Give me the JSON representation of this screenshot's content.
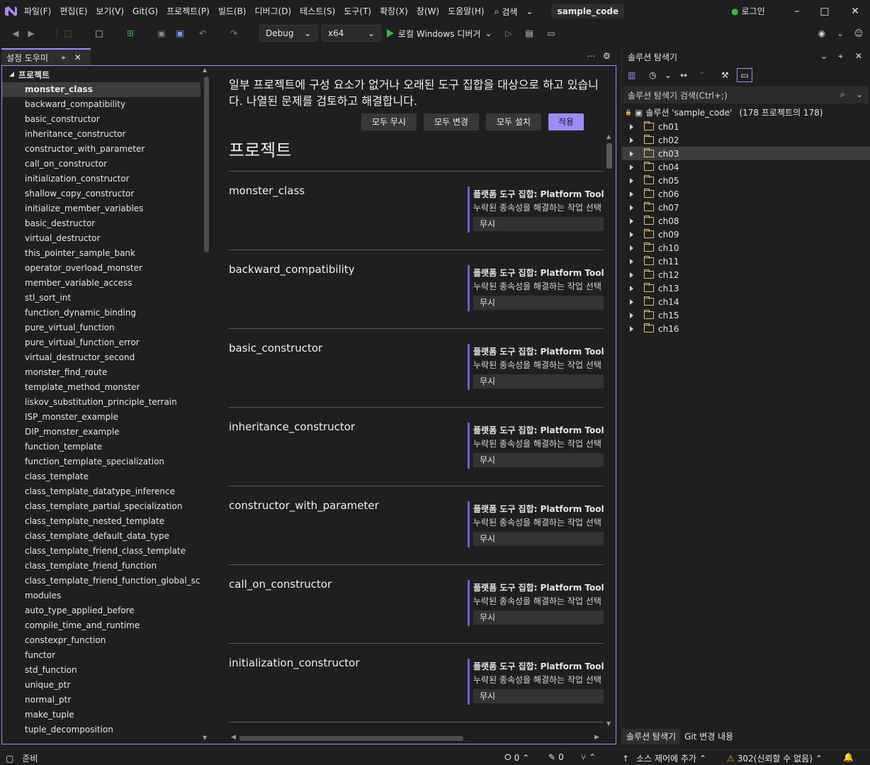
{
  "colors": {
    "accent": "#9c8dff",
    "apply": "#9d8cf7",
    "background": "#1f1f1f",
    "run_green": "#3bb54a",
    "folder": "#d9c27a"
  },
  "menu": {
    "items": [
      "파일(F)",
      "편집(E)",
      "보기(V)",
      "Git(G)",
      "프로젝트(P)",
      "빌드(B)",
      "디버그(D)",
      "테스트(S)",
      "도구(T)",
      "확장(X)",
      "창(W)",
      "도움말(H)"
    ],
    "search": "검색",
    "solution_name": "sample_code",
    "login": "로그인"
  },
  "toolbar": {
    "config": "Debug",
    "platform": "x64",
    "run_label": "로컬 Windows 디버거"
  },
  "left_tab": {
    "title": "설정 도우미"
  },
  "tree": {
    "root": "프로젝트",
    "items": [
      "monster_class",
      "backward_compatibility",
      "basic_constructor",
      "inheritance_constructor",
      "constructor_with_parameter",
      "call_on_constructor",
      "initialization_constructor",
      "shallow_copy_constructor",
      "initialize_member_variables",
      "basic_destructor",
      "virtual_destructor",
      "this_pointer_sample_bank",
      "operator_overload_monster",
      "member_variable_access",
      "stl_sort_int",
      "function_dynamic_binding",
      "pure_virtual_function",
      "pure_virtual_function_error",
      "virtual_destructor_second",
      "monster_find_route",
      "template_method_monster",
      "liskov_substitution_principle_terrain",
      "ISP_monster_example",
      "DIP_monster_example",
      "function_template",
      "function_template_specialization",
      "class_template",
      "class_template_datatype_inference",
      "class_template_partial_specialization",
      "class_template_nested_template",
      "class_template_default_data_type",
      "class_template_friend_class_template",
      "class_template_friend_function",
      "class_template_friend_function_global_scope",
      "modules",
      "auto_type_applied_before",
      "compile_time_and_runtime",
      "constexpr_function",
      "functor",
      "std_function",
      "unique_ptr",
      "normal_ptr",
      "make_tuple",
      "tuple_decomposition"
    ]
  },
  "content": {
    "notice": "일부 프로젝트에 구성 요소가 없거나 오래된 도구 집합을 대상으로 하고 있습니다. 나열된 문제를 검토하고 해결합니다.",
    "buttons": {
      "ignore_all": "모두 무시",
      "change_all": "모두 변경",
      "install_all": "모두 설치",
      "apply": "적용"
    },
    "title": "프로젝트",
    "issue_title": "플랫폼 도구 집합: Platform Toolset",
    "issue_desc": "누락된 종속성을 해결하는 작업 선택",
    "ignore_label": "무시",
    "projects": [
      "monster_class",
      "backward_compatibility",
      "basic_constructor",
      "inheritance_constructor",
      "constructor_with_parameter",
      "call_on_constructor",
      "initialization_constructor"
    ]
  },
  "solution_explorer": {
    "title": "솔루션 탐색기",
    "search_placeholder": "솔루션 탐색기 검색(Ctrl+;)",
    "solution_label": "솔루션 'sample_code'",
    "solution_count": "(178 프로젝트의 178)",
    "folders": [
      "ch01",
      "ch02",
      "ch03",
      "ch04",
      "ch05",
      "ch06",
      "ch07",
      "ch08",
      "ch09",
      "ch10",
      "ch11",
      "ch12",
      "ch13",
      "ch14",
      "ch15",
      "ch16"
    ],
    "selected_folder": "ch03",
    "tabs": [
      "솔루션 탐색기",
      "Git 변경 내용"
    ]
  },
  "status": {
    "ready": "준비",
    "errors": "0",
    "changes": "0",
    "add_to_source": "소스 제어에 추가",
    "untrusted": "302(신뢰할 수 없음)"
  }
}
